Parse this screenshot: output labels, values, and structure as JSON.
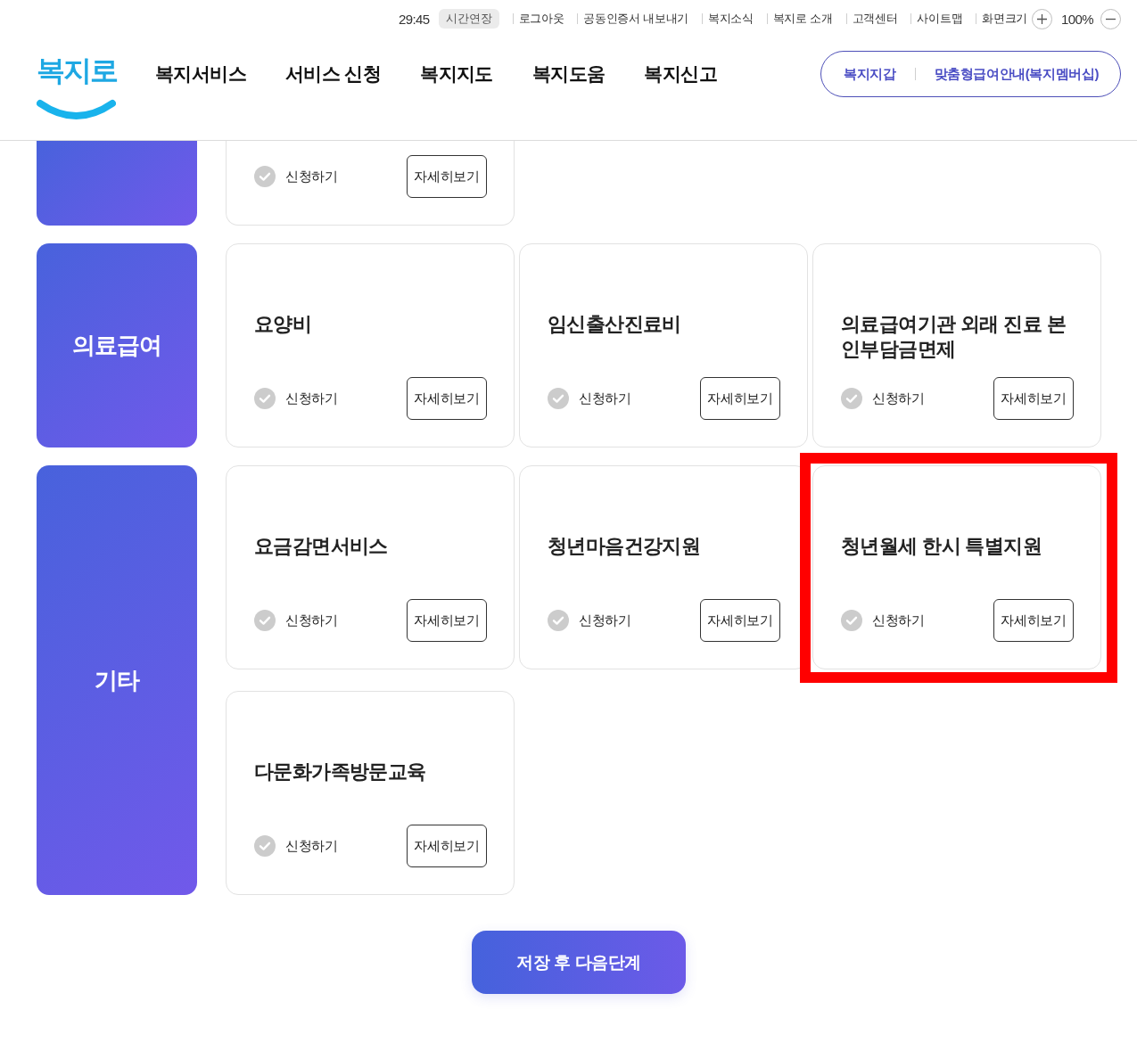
{
  "top_bar": {
    "timer": "29:45",
    "extend_button": "시간연장",
    "links": [
      "로그아웃",
      "공동인증서 내보내기",
      "복지소식",
      "복지로 소개",
      "고객센터",
      "사이트맵"
    ],
    "zoom": {
      "label": "화면크기",
      "value": "100%"
    }
  },
  "header": {
    "logo": "복지로",
    "nav": [
      "복지서비스",
      "서비스 신청",
      "복지지도",
      "복지도움",
      "복지신고"
    ],
    "quick_links": [
      "복지지갑",
      "맞춤형급여안내(복지멤버십)"
    ]
  },
  "sections": [
    {
      "cards": [
        {
          "apply": {
            "label": "신청하기",
            "checked": false
          },
          "detail_button": "자세히보기",
          "highlighted": false
        }
      ]
    },
    {
      "label": "의료급여",
      "cards": [
        {
          "title": "요양비",
          "apply": {
            "label": "신청하기",
            "checked": false
          },
          "detail_button": "자세히보기",
          "highlighted": false
        },
        {
          "title": "임신출산진료비",
          "apply": {
            "label": "신청하기",
            "checked": false
          },
          "detail_button": "자세히보기",
          "highlighted": false
        },
        {
          "title": "의료급여기관 외래 진료 본인부담금면제",
          "apply": {
            "label": "신청하기",
            "checked": false
          },
          "detail_button": "자세히보기",
          "highlighted": false
        }
      ]
    },
    {
      "label": "기타",
      "cards": [
        {
          "title": "요금감면서비스",
          "apply": {
            "label": "신청하기",
            "checked": false
          },
          "detail_button": "자세히보기",
          "highlighted": false
        },
        {
          "title": "청년마음건강지원",
          "apply": {
            "label": "신청하기",
            "checked": false
          },
          "detail_button": "자세히보기",
          "highlighted": false
        },
        {
          "title": "청년월세 한시 특별지원",
          "apply": {
            "label": "신청하기",
            "checked": false
          },
          "detail_button": "자세히보기",
          "highlighted": true
        },
        {
          "title": "다문화가족방문교육",
          "apply": {
            "label": "신청하기",
            "checked": false
          },
          "detail_button": "자세히보기",
          "highlighted": false
        }
      ]
    }
  ],
  "save_button": "저장 후 다음단계"
}
